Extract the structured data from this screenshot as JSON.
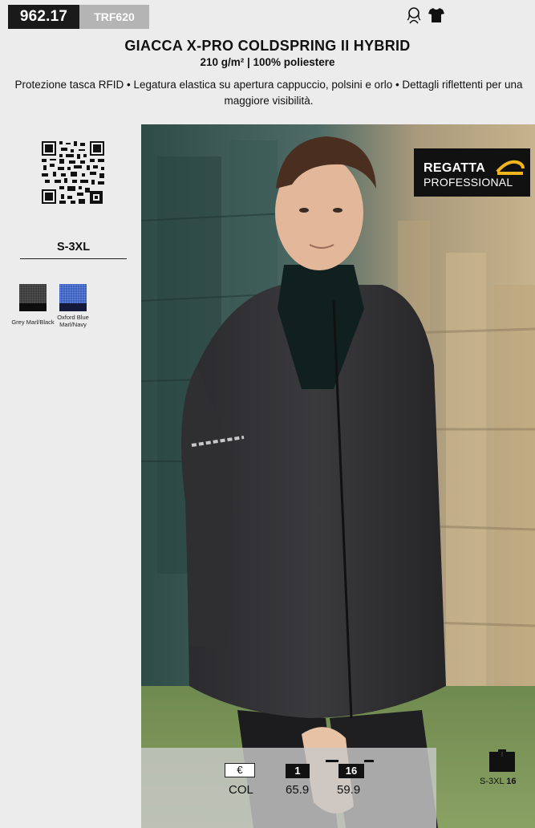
{
  "header": {
    "code": "962.17",
    "sku": "TRF620",
    "icons": [
      "woman-icon",
      "shirt-icon"
    ]
  },
  "product": {
    "title": "GIACCA X-PRO COLDSPRING II HYBRID",
    "subtitle": "210 g/m² | 100% poliestere",
    "features": "Protezione tasca RFID • Legatura elastica su apertura cappuccio, polsini e orlo • Dettagli riflettenti per una maggiore visibilità."
  },
  "sizes": "S-3XL",
  "colors": [
    {
      "name": "Grey Marl/Black",
      "top": "#3b3b3b",
      "bottom": "#0d0d0d"
    },
    {
      "name": "Oxford Blue Marl/Navy",
      "top": "#3a5fbf",
      "bottom": "#15193a"
    }
  ],
  "brand": {
    "line1": "REGATTA",
    "line2": "PROFESSIONAL"
  },
  "pricing": {
    "col_symbol": "€",
    "col_label": "COL",
    "tiers": [
      {
        "qty": "1",
        "price": "65.9"
      },
      {
        "qty": "16",
        "price": "59.9"
      }
    ]
  },
  "pack": {
    "size": "S-3XL",
    "qty": "16"
  }
}
